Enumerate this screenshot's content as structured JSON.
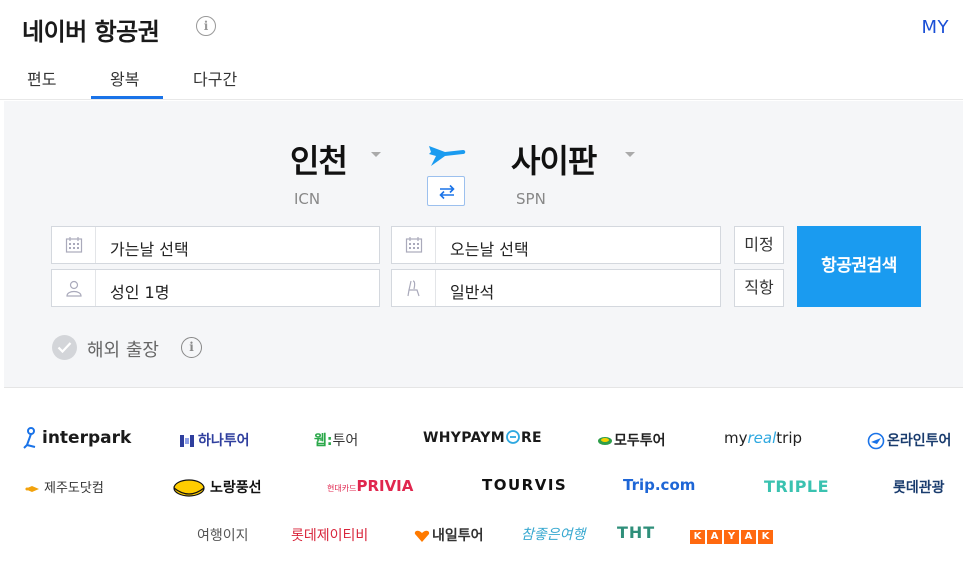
{
  "header": {
    "title": "네이버 항공권",
    "info_symbol": "i",
    "my_label": "MY"
  },
  "tabs": [
    {
      "label": "편도",
      "selected": false
    },
    {
      "label": "왕복",
      "selected": true
    },
    {
      "label": "다구간",
      "selected": false
    }
  ],
  "route": {
    "from_city": "인천",
    "from_code": "ICN",
    "to_city": "사이판",
    "to_code": "SPN",
    "plane_icon": "airplane-icon",
    "swap_icon": "swap-icon"
  },
  "form": {
    "departure_date": "가는날 선택",
    "return_date": "오는날 선택",
    "passengers": "성인 1명",
    "seat_class": "일반석",
    "undecided_label": "미정",
    "direct_label": "직항",
    "search_label": "항공권검색"
  },
  "business_trip": {
    "label": "해외 출장",
    "info_symbol": "i",
    "checked": false
  },
  "partners": {
    "row1": [
      "interpark",
      "하나투어",
      "웹투어",
      "WHYPAYMORE",
      "모두투어",
      "myrealtrip",
      "온라인투어"
    ],
    "row2": [
      "제주도닷컴",
      "노랑풍선",
      "PRIVIA",
      "TOURVIS",
      "Trip.com",
      "TRIPLE",
      "롯데관광"
    ],
    "row3": [
      "여행이지",
      "롯데제이티비",
      "내일투어",
      "참좋은여행",
      "THT",
      "KAYAK"
    ],
    "privia_prefix": "현대카드",
    "web_prefix": "웹",
    "web_suffix": "투어",
    "why_left": "WHYPAYM",
    "why_right": "RE",
    "myreal_left": "my",
    "myreal_mid": "real",
    "myreal_right": "trip",
    "tourvis_text": "TOURVIS",
    "kayak_letters": [
      "K",
      "A",
      "Y",
      "A",
      "K"
    ]
  },
  "colors": {
    "accent": "#1a9bf0",
    "tab_underline": "#1a73e8",
    "my_link": "#1a4fd6",
    "panel_bg": "#f5f6f8"
  }
}
